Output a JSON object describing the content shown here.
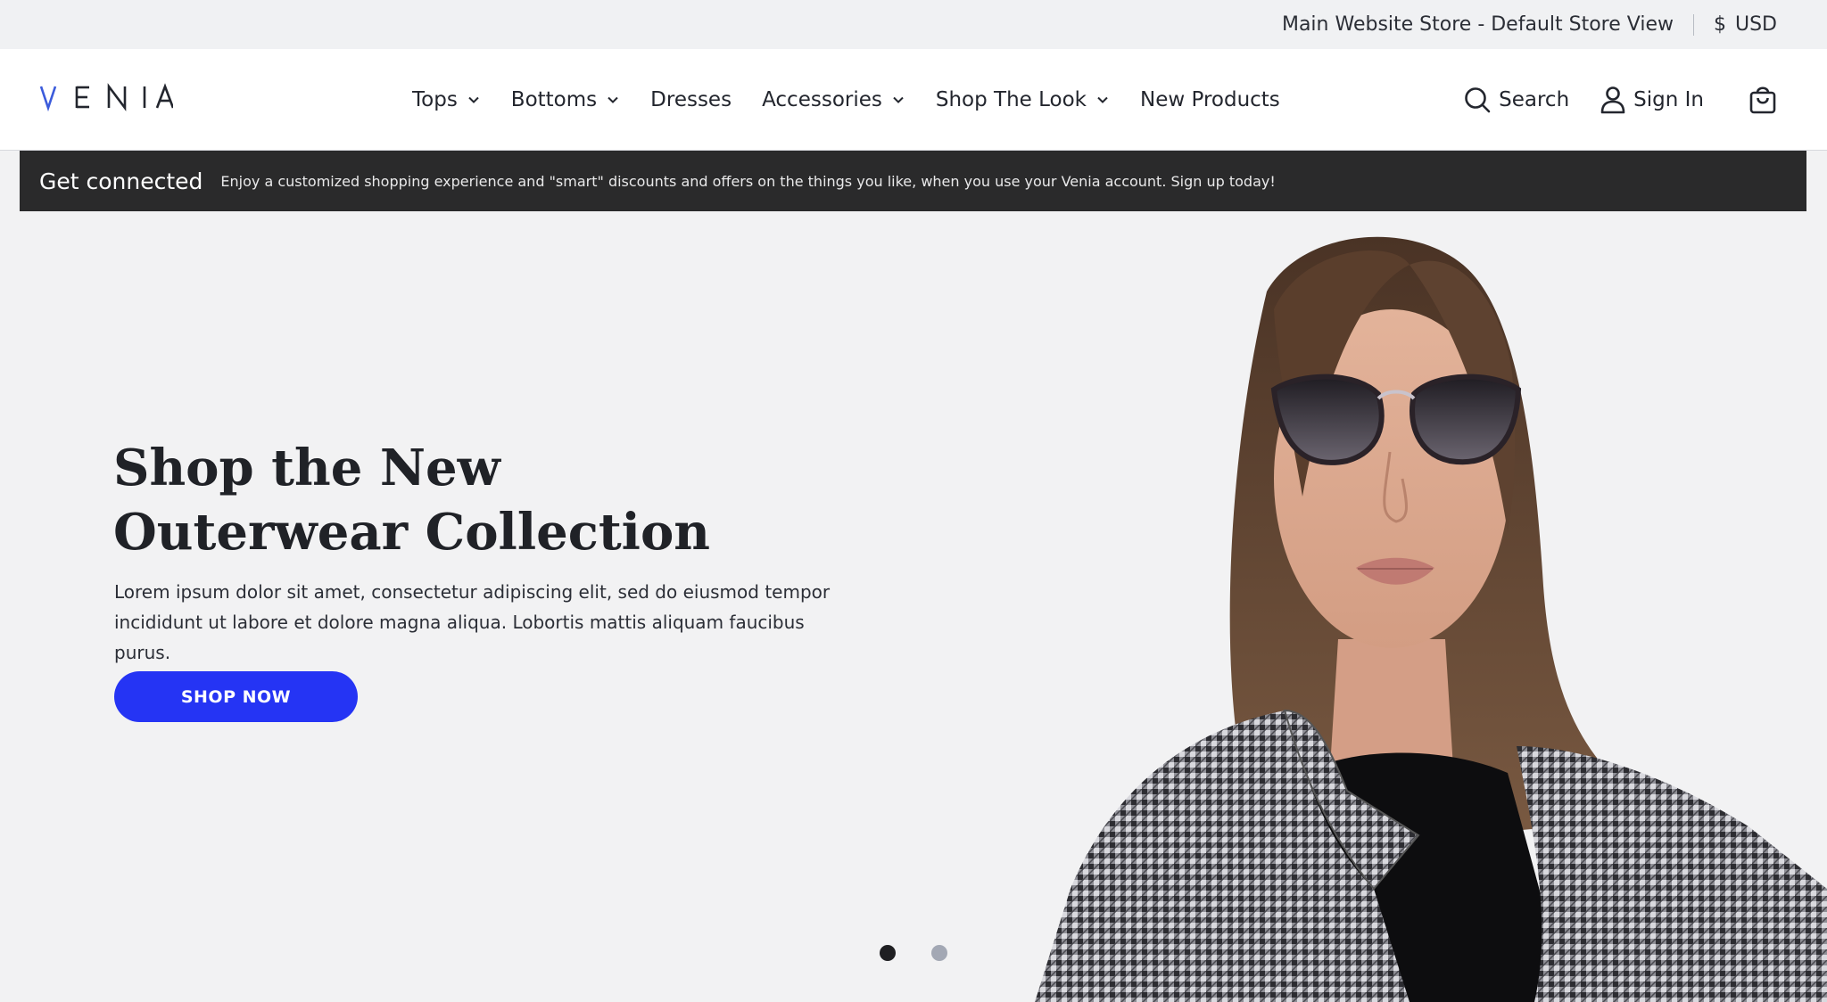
{
  "topbar": {
    "store_view": "Main Website Store - Default Store View",
    "currency_symbol": "$",
    "currency": "USD"
  },
  "header": {
    "logo_text": "VENIA",
    "nav": [
      {
        "label": "Tops",
        "has_dropdown": true
      },
      {
        "label": "Bottoms",
        "has_dropdown": true
      },
      {
        "label": "Dresses",
        "has_dropdown": false
      },
      {
        "label": "Accessories",
        "has_dropdown": true
      },
      {
        "label": "Shop The Look",
        "has_dropdown": true
      },
      {
        "label": "New Products",
        "has_dropdown": false
      }
    ],
    "search_label": "Search",
    "signin_label": "Sign In",
    "icons": {
      "search": "search-icon",
      "account": "user-icon",
      "cart": "shopping-bag-icon"
    }
  },
  "banner": {
    "title": "Get connected",
    "text": "Enjoy a customized shopping experience and \"smart\" discounts and offers on the things you like, when you use your Venia account. Sign up today!"
  },
  "hero": {
    "heading_line1": "Shop the New",
    "heading_line2": "Outerwear Collection",
    "body_line1": "Lorem ipsum dolor sit amet, consectetur adipiscing elit, sed do eiusmod tempor",
    "body_line2": "incididunt ut labore et dolore magna aliqua. Lobortis mattis aliquam faucibus purus.",
    "cta_label": "SHOP NOW",
    "slides_total": 2,
    "active_slide": 1
  },
  "colors": {
    "accent": "#2534f4",
    "banner_bg": "#2a2a2b",
    "topbar_bg": "#f0f1f3",
    "hero_bg": "#f2f2f3",
    "logo_accent": "#3b5bdb"
  }
}
